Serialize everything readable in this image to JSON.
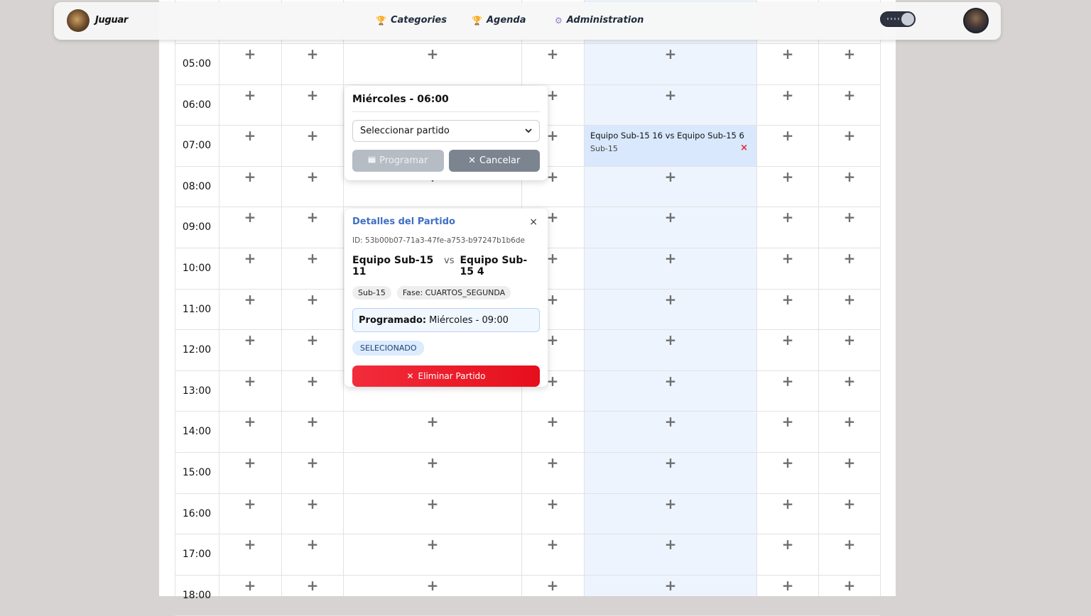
{
  "nav": {
    "brand": "Juguar",
    "links": [
      {
        "label": "Categories",
        "icon": "trophy-icon",
        "glyph": "🏆"
      },
      {
        "label": "Agenda",
        "icon": "trophy-icon",
        "glyph": "🏆"
      },
      {
        "label": "Administration",
        "icon": "gear-icon",
        "glyph": "⚙"
      }
    ]
  },
  "calendar": {
    "times": [
      "05:00",
      "06:00",
      "07:00",
      "08:00",
      "09:00",
      "10:00",
      "11:00",
      "12:00",
      "13:00",
      "14:00",
      "15:00",
      "16:00",
      "17:00",
      "18:00"
    ],
    "event": {
      "title": "Equipo Sub-15 16 vs Equipo Sub-15 6",
      "category": "Sub-15",
      "remove_glyph": "×"
    }
  },
  "schedule_popup": {
    "title": "Miércoles - 06:00",
    "select_value": "Seleccionar partido",
    "program_label": "Programar",
    "cancel_label": "Cancelar"
  },
  "details_popup": {
    "title": "Detalles del Partido",
    "close_glyph": "×",
    "id_text": "ID: 53b00b07-71a3-47fe-a753-b97247b1b6de",
    "team_home": "Equipo Sub-15 11",
    "vs": "vs",
    "team_away": "Equipo Sub-15 4",
    "category_chip": "Sub-15",
    "phase_chip": "Fase: CUARTOS_SEGUNDA",
    "scheduled_label": "Programado:",
    "scheduled_value": "Miércoles - 09:00",
    "status": "SELECIONADO",
    "delete_label": "Eliminar Partido"
  },
  "colors": {
    "accent": "#3f6fc4",
    "danger": "#e60f1c",
    "selected_column": "#edf4fe"
  }
}
